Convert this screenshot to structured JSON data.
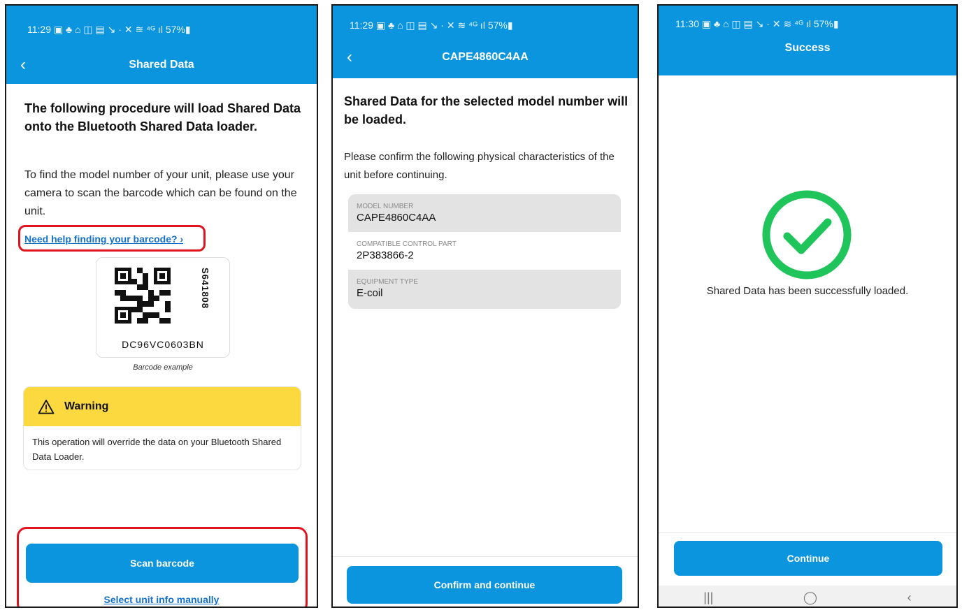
{
  "screens": {
    "intro": {
      "status_time": "11:29",
      "status_icons": "▣ ♣ ⌂ ◫ ▤ ↘ · ✕ ≋ ⁴ᴳ ıl 57%▮",
      "back_icon": "‹",
      "title": "Shared Data",
      "heading": "The following procedure will load Shared Data onto the Bluetooth Shared Data loader.",
      "body": "To find the model number of your unit, please use your camera to scan the  barcode which can be found on the unit.",
      "help_link": "Need help finding your barcode? ›",
      "barcode_serial": "S641808",
      "barcode_code": "DC96VC0603BN",
      "barcode_caption": "Barcode example",
      "warning_title": "Warning",
      "warning_icon": "warning-triangle-icon",
      "warning_text": "This operation will override the data on your Bluetooth Shared Data Loader.",
      "scan_button": "Scan barcode",
      "manual_link": "Select unit info manually"
    },
    "confirm": {
      "status_time": "11:29",
      "status_icons": "▣ ♣ ⌂ ◫ ▤ ↘ · ✕ ≋ ⁴ᴳ ıl 57%▮",
      "back_icon": "‹",
      "title": "CAPE4860C4AA",
      "heading": "Shared Data for the selected model number will be loaded.",
      "body": "Please confirm the following physical characteristics of the unit before continuing.",
      "fields": [
        {
          "label": "MODEL NUMBER",
          "value": "CAPE4860C4AA"
        },
        {
          "label": "COMPATIBLE CONTROL PART",
          "value": "2P383866-2"
        },
        {
          "label": "EQUIPMENT TYPE",
          "value": "E-coil"
        }
      ],
      "confirm_button": "Confirm and continue"
    },
    "success": {
      "status_time": "11:30",
      "status_icons": "▣ ♣ ⌂ ◫ ▤ ↘ · ✕ ≋ ⁴ᴳ ıl 57%▮",
      "title": "Success",
      "check_icon": "check-circle-icon",
      "message": "Shared Data has been successfully loaded.",
      "continue_button": "Continue",
      "nav_recent": "|||",
      "nav_home": "◯",
      "nav_back": "‹"
    }
  },
  "colors": {
    "primary": "#0a95de",
    "link": "#1572c8",
    "warning": "#fcd93f",
    "success": "#1fc45a",
    "highlight": "#e0141e"
  }
}
